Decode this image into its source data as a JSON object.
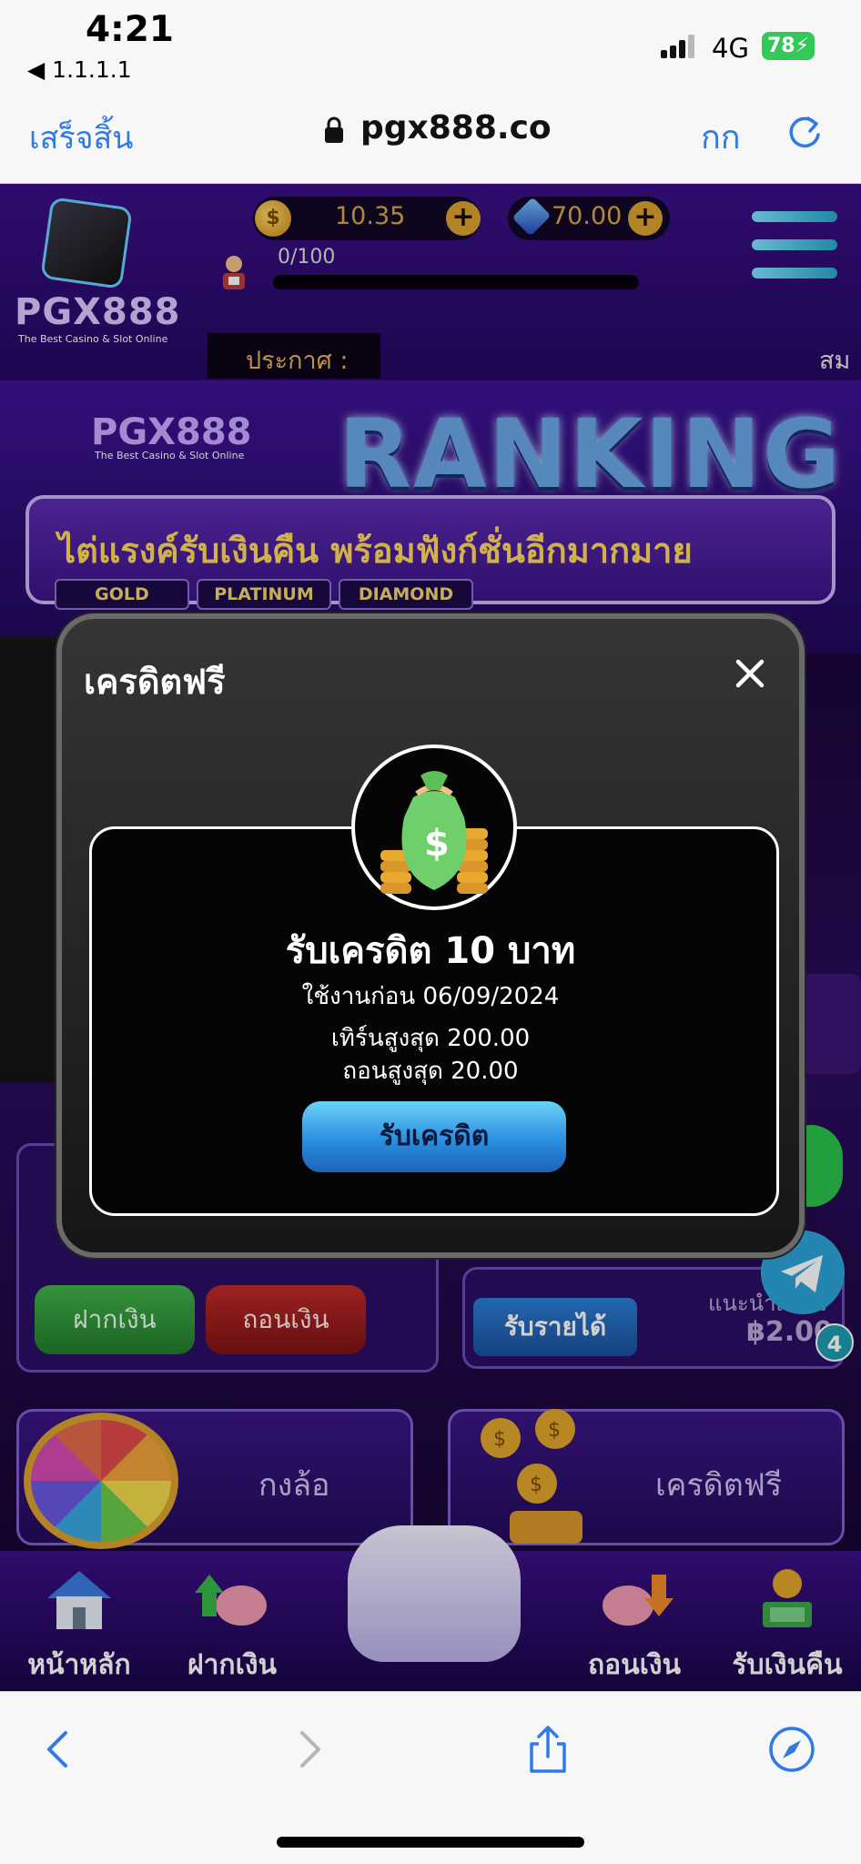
{
  "status": {
    "time": "4:21",
    "back_app": "◀ 1.1.1.1",
    "network": "4G",
    "battery": "78"
  },
  "browser": {
    "done_label": "เสร็จสิ้น",
    "url": "pgx888.co",
    "text_size_label": "กก"
  },
  "header": {
    "logo_text": "PGX888",
    "logo_tagline": "The Best Casino & Slot Online",
    "coin_balance": "10.35",
    "gem_balance": "70.00",
    "xp": "0/100",
    "announce_label": "ประกาศ :",
    "announce_scroll": "สม"
  },
  "banner": {
    "logo_text": "PGX888",
    "logo_tagline": "The Best Casino & Slot Online",
    "title": "RANKING",
    "headline": "ไต่แรงค์รับเงินคืน พร้อมฟังก์ชั่นอีกมากมาย",
    "tiers": [
      "GOLD",
      "PLATINUM",
      "DIAMOND"
    ]
  },
  "wallet": {
    "deposit_label": "ฝากเงิน",
    "withdraw_label": "ถอนเงิน"
  },
  "affiliate": {
    "earn_label": "รับรายได้",
    "recommend_label": "แนะนำเพื่อน",
    "amount": "฿2.00",
    "notif_count": "4"
  },
  "promos": {
    "wheel_label": "กงล้อ",
    "credit_label": "เครดิตฟรี"
  },
  "bottom_nav": {
    "items": [
      {
        "label": "หน้าหลัก",
        "icon": "house-icon"
      },
      {
        "label": "ฝากเงิน",
        "icon": "deposit-piggy-icon"
      },
      {
        "label": "ถอนเงิน",
        "icon": "withdraw-piggy-icon"
      },
      {
        "label": "รับเงินคืน",
        "icon": "cashback-icon"
      }
    ],
    "center_icon": "gamepad-icon"
  },
  "modal": {
    "title": "เครดิตฟรี",
    "credit_title": "รับเครดิต 10 บาท",
    "expiry": "ใช้งานก่อน 06/09/2024",
    "max_turnover": "เทิร์นสูงสุด 200.00",
    "max_withdraw": "ถอนสูงสุด 20.00",
    "claim_label": "รับเครดิต"
  },
  "colors": {
    "brand_purple": "#2b0a63",
    "accent_gold": "#d9a22e",
    "claim_blue": "#2b8ee0",
    "safari_blue": "#2f7ae5"
  }
}
